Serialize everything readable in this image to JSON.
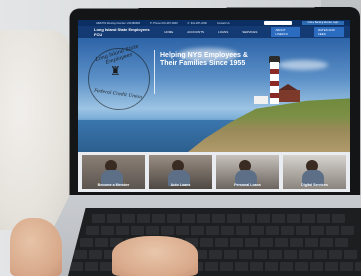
{
  "site": {
    "topbar": {
      "routing": "ABA/TIN Routing Number: 221380682",
      "phone": "P: Phone 631-287-0900",
      "fax": "F: 631-287-2200",
      "contact": "Contact Us",
      "login_label": "Online Banking Member Login"
    },
    "brand": "Long Island State Employees FCU",
    "nav": [
      "HOME",
      "ACCOUNTS",
      "LOANS",
      "SERVICES",
      "ABOUT LISEFCU",
      "RATES AND FEES"
    ],
    "hero": {
      "logo_top": "Long Island State Employees",
      "logo_bottom": "Federal Credit Union",
      "title": "Helping NYS Employees & Their Families Since 1955"
    },
    "tiles": [
      {
        "label": "Become a Member"
      },
      {
        "label": "Auto Loans"
      },
      {
        "label": "Personal Loans"
      },
      {
        "label": "Digital Services"
      }
    ]
  },
  "colors": {
    "nav_bg": "#143a73",
    "topbar_bg": "#0b2f63",
    "accent": "#2b6cc0"
  }
}
